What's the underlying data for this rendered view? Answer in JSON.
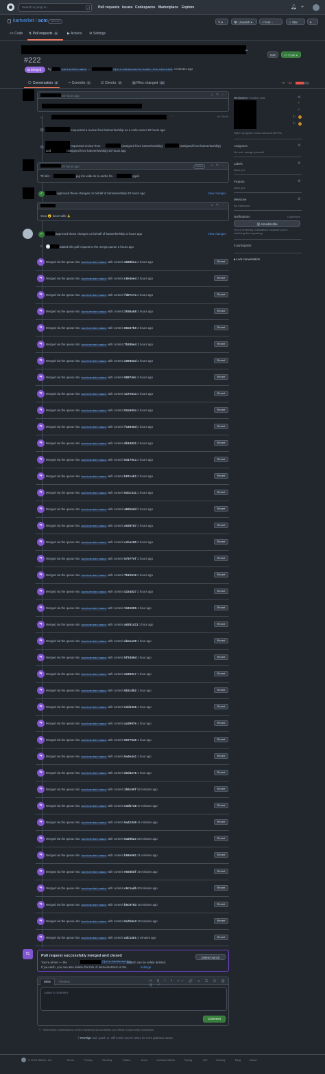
{
  "topbar": {
    "search_placeholder": "Search or jump to...",
    "slash_key": "/",
    "nav": [
      "Pull requests",
      "Issues",
      "Codespaces",
      "Marketplace",
      "Explore"
    ]
  },
  "repo": {
    "owner": "kartverket",
    "separator": "/",
    "name": "acm",
    "visibility": "Internal",
    "buttons": {
      "unwatch": "Unwatch",
      "fork": "Fork",
      "star": "Star"
    },
    "tabs": [
      {
        "label": "Code"
      },
      {
        "label": "Pull requests",
        "count": "6"
      },
      {
        "label": "Actions"
      },
      {
        "label": "Settings"
      }
    ]
  },
  "pr": {
    "number": "#222",
    "edit_label": "Edit",
    "code_label": "Code",
    "status": "Merged",
    "meta_by": "by",
    "base_branch": "kartverket:main",
    "arrow": "←",
    "head_branch": "fjern-kanoniserte-sider-fra-nettsted",
    "meta_time": "4 minutes ago",
    "tabs": [
      {
        "label": "Conversation",
        "count": "8"
      },
      {
        "label": "Commits",
        "count": "1"
      },
      {
        "label": "Checks",
        "count": "0"
      },
      {
        "label": "Files changed",
        "count": "12"
      }
    ],
    "diffstat_add": "+0",
    "diffstat_del": "−33"
  },
  "timeline": {
    "first_comment_time": "20 hours ago",
    "commit_sha": "e713cdb",
    "review_request_1": "requested a review from kartverket/skip as a code owner 20 hours ago",
    "review_request_2a": "requested review from",
    "review_request_2b": "(assigned from kartverket/skip),",
    "review_request_2c": "(assigned from kartverket/skip)",
    "review_request_2d": "and",
    "review_request_2e": "(assigned from kartverket/skip) 20 hours ago",
    "comment2_time": "20 hours ago",
    "author_badge": "Author",
    "comment2_body_a": "Til info:",
    "comment2_body_b": "jeg tok vekk de to andre fra",
    "comment2_body_c": "også.",
    "approve1": "approved these changes on behalf of kartverket/skip 20 hours ago",
    "approve_link": "View changes",
    "comment3_body": "Wow 😮 fusen takk 🙏",
    "approve2": "approved these changes on behalf of kartverket/skip 3 hours ago",
    "merge_queue": "added this pull request to the merge queue 3 hours ago",
    "merged_prefix": "Merged via the queue into",
    "merged_branch": "kartverket:main",
    "merged_with": "with commit",
    "revert_label": "Revert",
    "merges": [
      {
        "sha": "4588bea",
        "time": "3 hours ago"
      },
      {
        "sha": "c8e4ee4",
        "time": "3 hours ago"
      },
      {
        "sha": "fd0717a",
        "time": "3 hours ago"
      },
      {
        "sha": "2936a58",
        "time": "3 hours ago"
      },
      {
        "sha": "80a07b0",
        "time": "3 hours ago"
      },
      {
        "sha": "7b205e4",
        "time": "3 hours ago"
      },
      {
        "sha": "a66652d",
        "time": "3 hours ago"
      },
      {
        "sha": "98874dc",
        "time": "3 hours ago"
      },
      {
        "sha": "117e514",
        "time": "3 hours ago"
      },
      {
        "sha": "52a592a",
        "time": "2 hours ago"
      },
      {
        "sha": "fc8036d",
        "time": "2 hours ago"
      },
      {
        "sha": "db10831",
        "time": "2 hours ago"
      },
      {
        "sha": "54179ca",
        "time": "2 hours ago"
      },
      {
        "sha": "b87ceb1",
        "time": "2 hours ago"
      },
      {
        "sha": "6cbc411",
        "time": "2 hours ago"
      },
      {
        "sha": "400b6dd",
        "time": "2 hours ago"
      },
      {
        "sha": "a638787",
        "time": "2 hours ago"
      },
      {
        "sha": "ccba185",
        "time": "2 hours ago"
      },
      {
        "sha": "5797fef",
        "time": "2 hours ago"
      },
      {
        "sha": "7b1b519",
        "time": "2 hours ago"
      },
      {
        "sha": "433a827",
        "time": "2 hours ago"
      },
      {
        "sha": "1181995",
        "time": "1 hour ago"
      },
      {
        "sha": "a0251411",
        "time": "1 hour ago"
      },
      {
        "sha": "abaea39",
        "time": "1 hour ago"
      },
      {
        "sha": "5f8360d",
        "time": "1 hour ago"
      },
      {
        "sha": "3e859c7",
        "time": "1 hour ago"
      },
      {
        "sha": "0b2cd82",
        "time": "1 hour ago"
      },
      {
        "sha": "ecbb336",
        "time": "1 hour ago"
      },
      {
        "sha": "aa3097e",
        "time": "1 hour ago"
      },
      {
        "sha": "9077049",
        "time": "1 hour ago"
      },
      {
        "sha": "0a4e4a1",
        "time": "1 hour ago"
      },
      {
        "sha": "d2d4278",
        "time": "1 hour ago"
      },
      {
        "sha": "1b0c59f",
        "time": "52 minutes ago"
      },
      {
        "sha": "e3db738",
        "time": "47 minutes ago"
      },
      {
        "sha": "6a41349",
        "time": "41 minutes ago"
      },
      {
        "sha": "0a89bae",
        "time": "36 minutes ago"
      },
      {
        "sha": "b58e561",
        "time": "31 minutes ago"
      },
      {
        "sha": "e926bdf",
        "time": "25 minutes ago"
      },
      {
        "sha": "c9c1adb",
        "time": "20 minutes ago"
      },
      {
        "sha": "b5c0783",
        "time": "15 minutes ago"
      },
      {
        "sha": "6a7b6a3",
        "time": "10 minutes ago"
      },
      {
        "sha": "adc1a61",
        "time": "4 minutes ago"
      }
    ]
  },
  "merged_box": {
    "title": "Pull request successfully merged and closed",
    "line1a": "You're all set — the",
    "line1b": "fjern-kanoniserte-",
    "line1c": "branch can be safely deleted.",
    "line2": "If you wish, you can also delete this fork of kartverket/acm in the",
    "line2_link": "settings.",
    "delete_branch": "Delete branch"
  },
  "comment_box": {
    "write_tab": "Write",
    "preview_tab": "Preview",
    "placeholder": "Leave a comment",
    "submit": "Comment",
    "reminder": "Remember, contributions to this repository should follow our GitHub Community Guidelines.",
    "protip_a": "ProTip!",
    "protip_b": "Add .patch or .diff to the end of URLs for Git's plaintext views."
  },
  "sidebar": {
    "reviewers_label": "Reviewers",
    "reviewers_sub": "• review now",
    "still_in_progress": "Still in progress? Learn about draft PRs",
    "assignees_label": "Assignees",
    "assignees_value": "No one—assign yourself",
    "labels_label": "Labels",
    "labels_value": "None yet",
    "projects_label": "Projects",
    "projects_value": "None yet",
    "milestone_label": "Milestone",
    "milestone_value": "No milestone",
    "notifications_label": "Notifications",
    "customize": "Customize",
    "unsubscribe": "Unsubscribe",
    "notif_desc": "You're receiving notifications because you're watching this repository.",
    "participants": "0 participants",
    "lock": "Lock conversation"
  },
  "footer": {
    "copyright": "© 2023 GitHub, Inc.",
    "links": [
      "Terms",
      "Privacy",
      "Security",
      "Status",
      "Docs",
      "Contact GitHub",
      "Pricing",
      "API",
      "Training",
      "Blog",
      "About"
    ]
  },
  "colors": {
    "accent": "#539bf5",
    "merged": "#986ee2",
    "green": "#347d39",
    "bg": "#22272e"
  }
}
